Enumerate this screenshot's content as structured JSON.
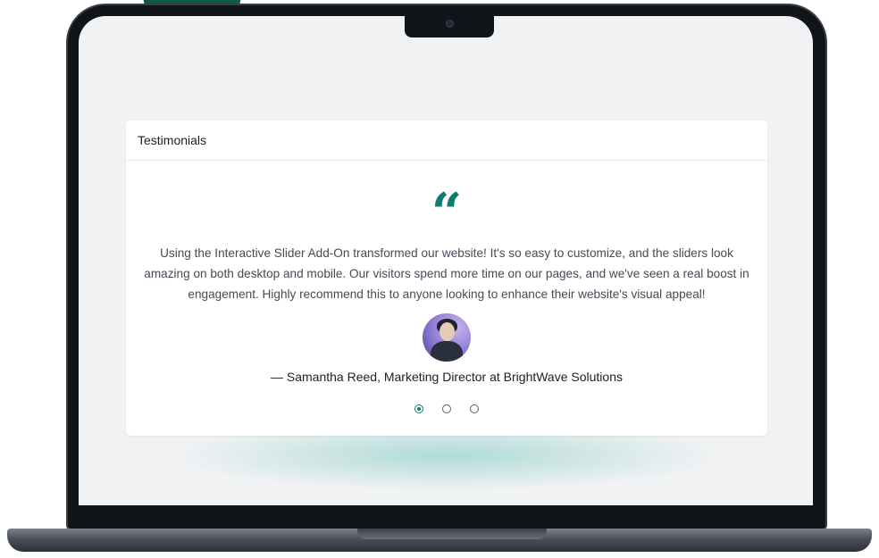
{
  "card": {
    "title": "Testimonials"
  },
  "testimonial": {
    "quote_icon": "quote-open-icon",
    "text": "Using the Interactive Slider Add-On transformed our website! It's so easy to customize, and the sliders look amazing on both desktop and mobile. Our visitors spend more time on our pages, and we've seen a real boost in engagement. Highly recommend this to anyone looking to enhance their website's visual appeal!",
    "author": "— Samantha Reed, Marketing Director at BrightWave Solutions"
  },
  "pagination": {
    "count": 3,
    "active_index": 0
  },
  "colors": {
    "accent": "#0f7d6b",
    "decor_green": "#0e5a47"
  }
}
